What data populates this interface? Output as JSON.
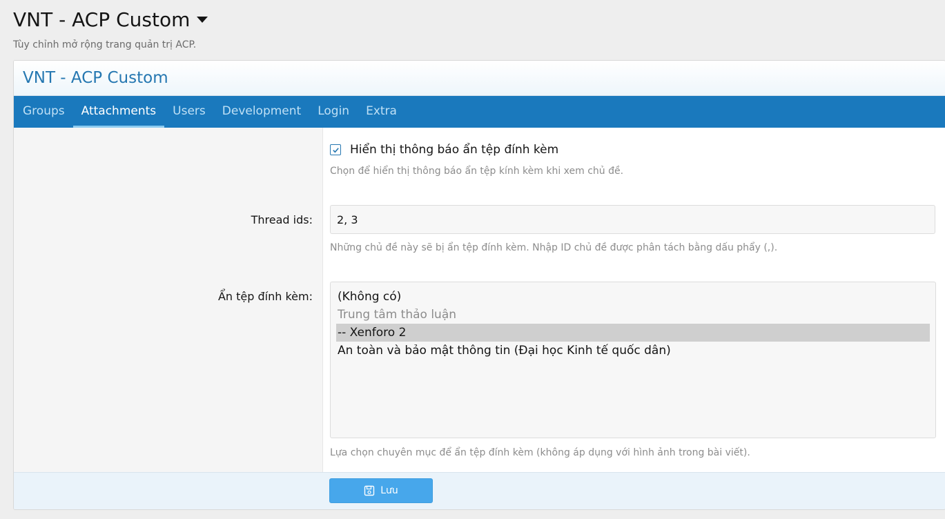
{
  "page": {
    "title": "VNT - ACP Custom",
    "description": "Tùy chỉnh mở rộng trang quản trị ACP."
  },
  "block": {
    "title": "VNT - ACP Custom",
    "tabs": [
      {
        "label": "Groups",
        "active": false
      },
      {
        "label": "Attachments",
        "active": true
      },
      {
        "label": "Users",
        "active": false
      },
      {
        "label": "Development",
        "active": false
      },
      {
        "label": "Login",
        "active": false
      },
      {
        "label": "Extra",
        "active": false
      }
    ]
  },
  "form": {
    "show_notice": {
      "checked": true,
      "label": "Hiển thị thông báo ẩn tệp đính kèm",
      "explain": "Chọn để hiển thị thông báo ẩn tệp kính kèm khi xem chủ đề."
    },
    "thread_ids": {
      "label": "Thread ids:",
      "value": "2, 3",
      "explain": "Những chủ đề này sẽ bị ẩn tệp đính kèm. Nhập ID chủ đề được phân tách bằng dấu phẩy (,)."
    },
    "hide_attachments": {
      "label": "Ẩn tệp đính kèm:",
      "options": [
        {
          "label": "(Không có)",
          "disabled": false,
          "selected": false
        },
        {
          "label": "Trung tâm thảo luận",
          "disabled": true,
          "selected": false
        },
        {
          "label": "-- Xenforo 2",
          "disabled": false,
          "selected": true
        },
        {
          "label": "An toàn và bảo mật thông tin (Đại học Kinh tế quốc dân)",
          "disabled": false,
          "selected": false
        }
      ],
      "explain": "Lựa chọn chuyên mục để ẩn tệp đính kèm (không áp dụng với hình ảnh trong bài viết)."
    }
  },
  "footer": {
    "save_label": "Lưu",
    "save_icon": "save-icon"
  },
  "colors": {
    "accent": "#2577b1",
    "tab_bar": "#1a79bd",
    "button": "#47a7eb"
  }
}
